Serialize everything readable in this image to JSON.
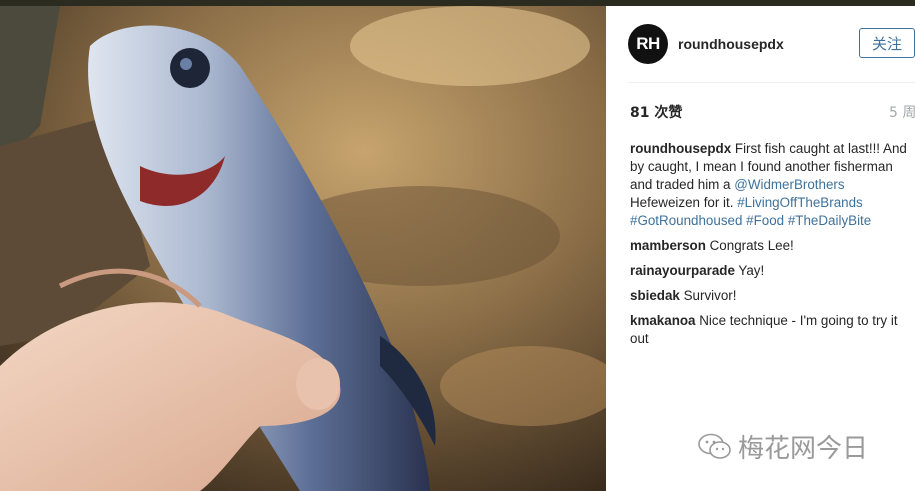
{
  "post": {
    "username": "roundhousepdx",
    "avatar_initials": "RH",
    "follow_label": "关注",
    "likes": "81 次赞",
    "age": "5 周",
    "caption": {
      "username": "roundhousepdx",
      "text1": "First fish caught at last!!! And by caught, I mean I found another fisherman and traded him a",
      "mention": "@WidmerBrothers",
      "text2": "Hefeweizen for it.",
      "hashtags": [
        "#LivingOffTheBrands",
        "#GotRoundhoused",
        "#Food",
        "#TheDailyBite"
      ]
    },
    "comments": [
      {
        "username": "mamberson",
        "text": "Congrats Lee!"
      },
      {
        "username": "rainayourparade",
        "text": "Yay!"
      },
      {
        "username": "sbiedak",
        "text": "Survivor!"
      },
      {
        "username": "kmakanoa",
        "text": "Nice technique - I'm going to try it out"
      }
    ]
  },
  "watermark": {
    "text": "梅花网今日",
    "icon": "wechat-icon"
  },
  "colors": {
    "link": "#3f729b",
    "text": "#262626",
    "muted": "#a5a7aa"
  }
}
